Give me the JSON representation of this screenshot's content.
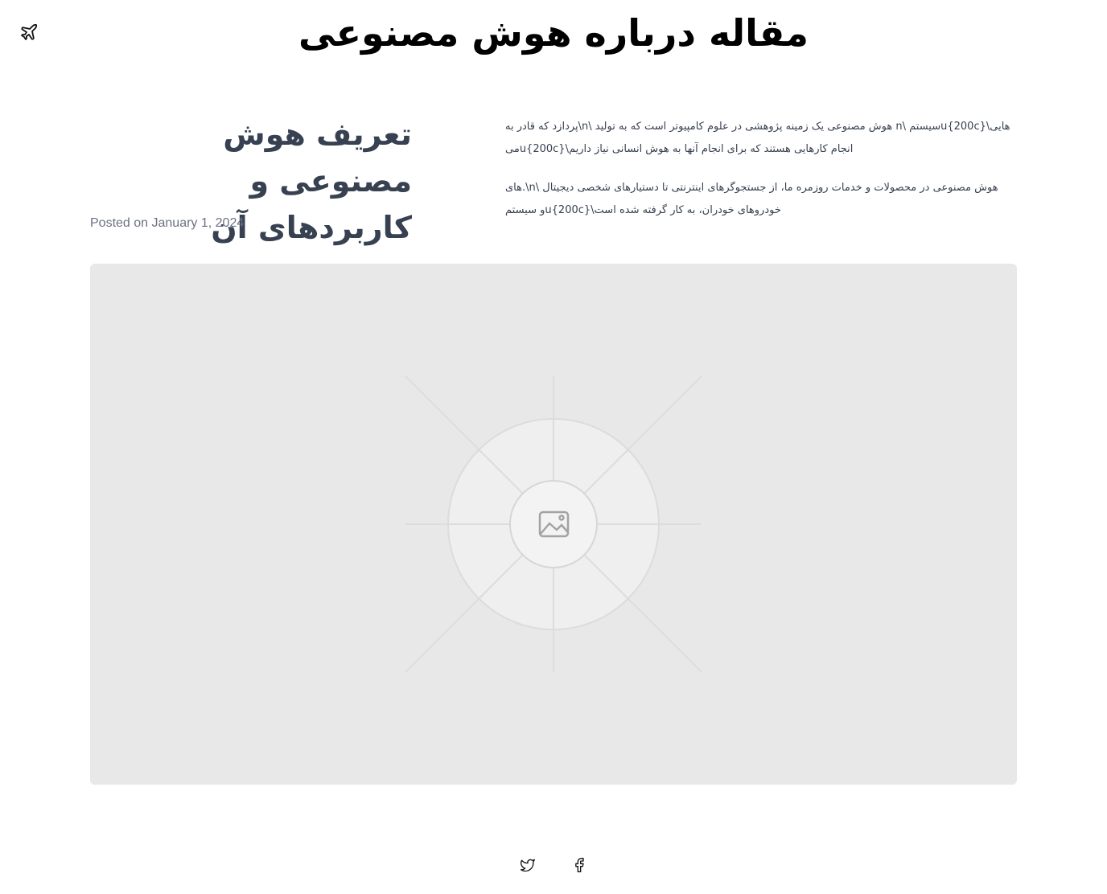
{
  "header": {
    "logo_icon": "plane-icon",
    "site_title": "مقاله درباره هوش مصنوعی"
  },
  "article": {
    "title": "تعریف هوش مصنوعی و کاربردهای آن",
    "posted": "Posted on January 1, 2024",
    "paragraphs": [
      "هایی\\u{200c}سیستم \\n هوش مصنوعی یک زمینه پژوهشی در علوم کامپیوتر است که به تولید \\n\\پردازد که قادر به انجام کارهایی هستند که برای انجام آنها به هوش انسانی نیاز داریم\\u{200c}می",
      "هوش مصنوعی در محصولات و خدمات روزمره ما، از جستجوگرهای اینترنتی تا دستیارهای شخصی دیجیتال \\n\\.های خودروهای خودران، به کار گرفته شده است\\u{200c}و سیستم"
    ],
    "image": {
      "icon": "image-placeholder-icon"
    }
  },
  "social": {
    "twitter_icon": "twitter-icon",
    "facebook_icon": "facebook-icon"
  },
  "colors": {
    "heading": "#374151",
    "meta": "#6b7280",
    "placeholder_bg": "#e8e8e8"
  }
}
